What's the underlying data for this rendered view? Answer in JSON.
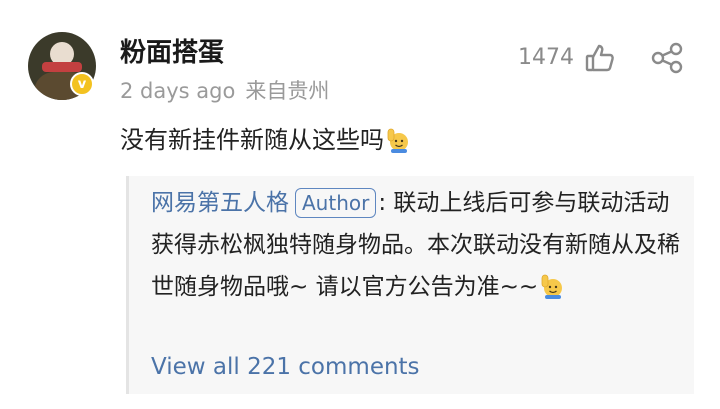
{
  "comment": {
    "username": "粉面搭蛋",
    "time": "2 days ago",
    "location": "来自贵州",
    "likes": "1474",
    "text": "没有新挂件新随从这些吗",
    "avatar_badge": "v"
  },
  "reply": {
    "author": "网易第五人格",
    "badge": "Author",
    "separator": ": ",
    "text": "联动上线后可参与联动活动获得赤松枫独特随身物品。本次联动没有新随从及稀世随身物品哦~ 请以官方公告为准~~"
  },
  "view_all": "View all 221 comments",
  "icons": {
    "like": "thumbs-up-icon",
    "share": "share-icon",
    "emoji": "raising-hand-emoji"
  },
  "colors": {
    "link": "#4b73a8",
    "muted": "#9a9a9a",
    "reply_bg": "#f7f7f7",
    "badge_yellow": "#f3c220"
  }
}
